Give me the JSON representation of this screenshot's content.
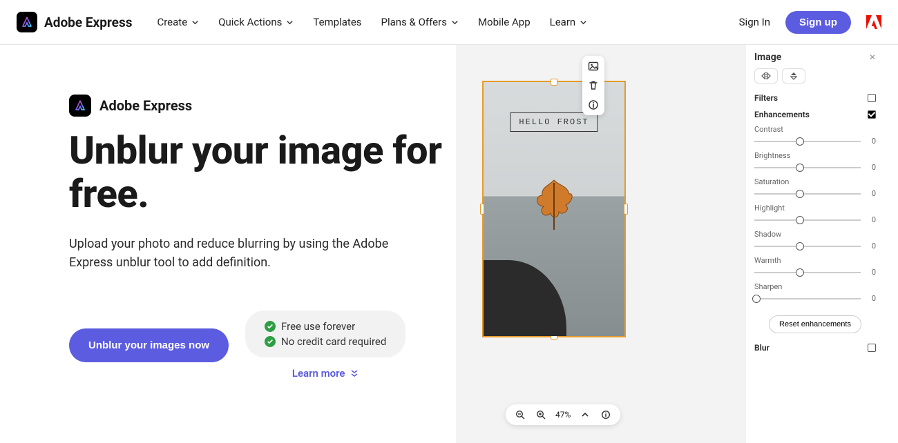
{
  "brand": "Adobe Express",
  "nav": {
    "items": [
      {
        "label": "Create",
        "hasDropdown": true
      },
      {
        "label": "Quick Actions",
        "hasDropdown": true
      },
      {
        "label": "Templates",
        "hasDropdown": false
      },
      {
        "label": "Plans & Offers",
        "hasDropdown": true
      },
      {
        "label": "Mobile App",
        "hasDropdown": false
      },
      {
        "label": "Learn",
        "hasDropdown": true
      }
    ],
    "signin": "Sign In",
    "signup": "Sign up"
  },
  "hero": {
    "mini_brand": "Adobe Express",
    "headline": "Unblur your image for free.",
    "description": "Upload your photo and reduce blurring by using the Adobe Express unblur tool to add definition.",
    "cta": "Unblur your images now",
    "benefits": [
      "Free use forever",
      "No credit card required"
    ],
    "learn_more": "Learn more"
  },
  "editor": {
    "caption": "HELLO FROST",
    "tools": [
      "image",
      "delete",
      "info"
    ],
    "zoom": {
      "value": "47%"
    },
    "panel": {
      "title": "Image",
      "filters_label": "Filters",
      "filters_expanded": false,
      "enhancements_label": "Enhancements",
      "enhancements_expanded": true,
      "sliders": [
        {
          "name": "Contrast",
          "value": 0,
          "pos": 43
        },
        {
          "name": "Brightness",
          "value": 0,
          "pos": 43
        },
        {
          "name": "Saturation",
          "value": 0,
          "pos": 43
        },
        {
          "name": "Highlight",
          "value": 0,
          "pos": 43
        },
        {
          "name": "Shadow",
          "value": 0,
          "pos": 43
        },
        {
          "name": "Warmth",
          "value": 0,
          "pos": 43
        },
        {
          "name": "Sharpen",
          "value": 0,
          "pos": 2
        }
      ],
      "reset": "Reset enhancements",
      "blur_label": "Blur",
      "blur_expanded": false
    }
  }
}
